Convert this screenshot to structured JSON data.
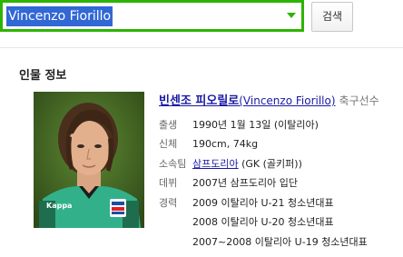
{
  "search": {
    "query": "Vincenzo Fiorillo",
    "button_label": "검색"
  },
  "profile": {
    "section_title": "인물 정보",
    "name_ko": "빈센조 피오릴로",
    "name_en": "(Vincenzo Fiorillo)",
    "role": "축구선수",
    "fields": [
      {
        "label": "출생",
        "value": "1990년 1월 13일 (이탈리아)"
      },
      {
        "label": "신체",
        "value": "190cm, 74kg"
      },
      {
        "label": "소속팀",
        "value_link": "삼프도리아",
        "value_rest": " (GK (골키퍼))"
      },
      {
        "label": "데뷔",
        "value": "2007년 삼프도리아 입단"
      }
    ],
    "career_label": "경력",
    "career": [
      "2009 이탈리아 U-21 청소년대표",
      "2008 이탈리아 U-20 청소년대표",
      "2007~2008 이탈리아 U-19 청소년대표"
    ],
    "photo_jersey_text": "Kappa"
  },
  "colors": {
    "search_border": "#2db400",
    "selection": "#3168d5",
    "link": "#1a1aa6"
  }
}
